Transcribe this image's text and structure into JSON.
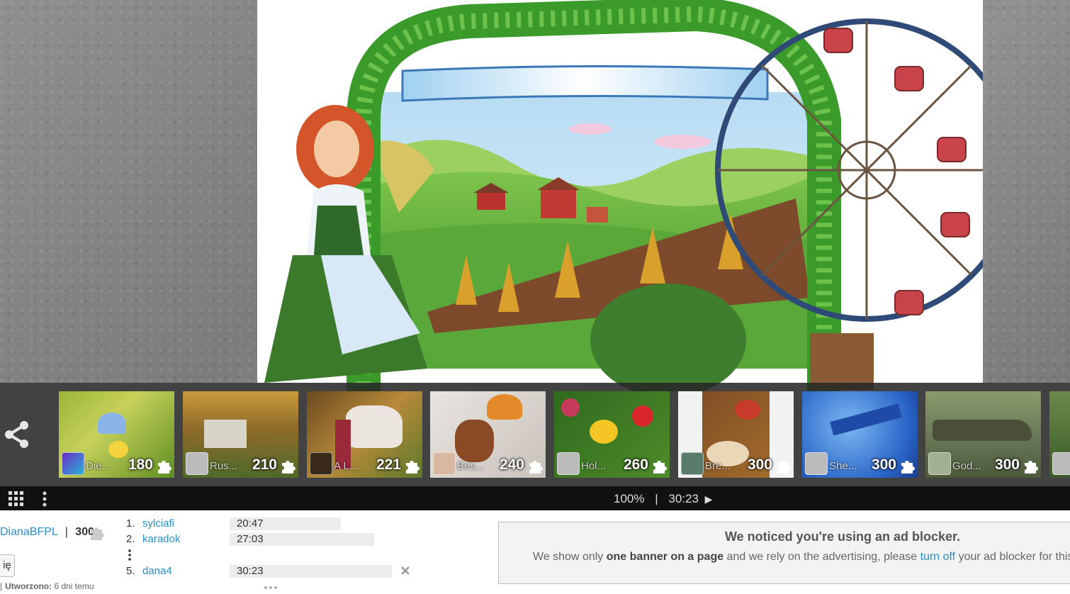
{
  "thumbnails": [
    {
      "author": "Die...",
      "pieces": "180"
    },
    {
      "author": "Rus...",
      "pieces": "210"
    },
    {
      "author": "A L...",
      "pieces": "221"
    },
    {
      "author": "Bes...",
      "pieces": "240"
    },
    {
      "author": "Hol...",
      "pieces": "260"
    },
    {
      "author": "Bre...",
      "pieces": "300"
    },
    {
      "author": "She...",
      "pieces": "300"
    },
    {
      "author": "God...",
      "pieces": "300"
    }
  ],
  "toolbar": {
    "zoom": "100%",
    "separator": "|",
    "timer": "30:23",
    "play_icon": "▶"
  },
  "puzzle_info": {
    "author": "DianaBFPL",
    "separator": "|",
    "pieces": "300",
    "button_label": "ię",
    "created_label": "Utworzono:",
    "created_value": "6 dni temu"
  },
  "leaderboard": [
    {
      "rank": "1.",
      "name": "sylciafi",
      "time": "20:47"
    },
    {
      "rank": "2.",
      "name": "karadok",
      "time": "27:03"
    },
    {
      "rank": "5.",
      "name": "dana4",
      "time": "30:23"
    }
  ],
  "ad_notice": {
    "title": "We noticed you're using an ad blocker.",
    "text_1": "We show only ",
    "text_bold": "one banner on a page",
    "text_2": " and we rely on the advertising, please ",
    "text_link": "turn off",
    "text_3": " your ad blocker for this"
  },
  "colors": {
    "link": "#2a8fc9",
    "toolbar_bg": "#111111",
    "strip_bg": "#282828"
  }
}
